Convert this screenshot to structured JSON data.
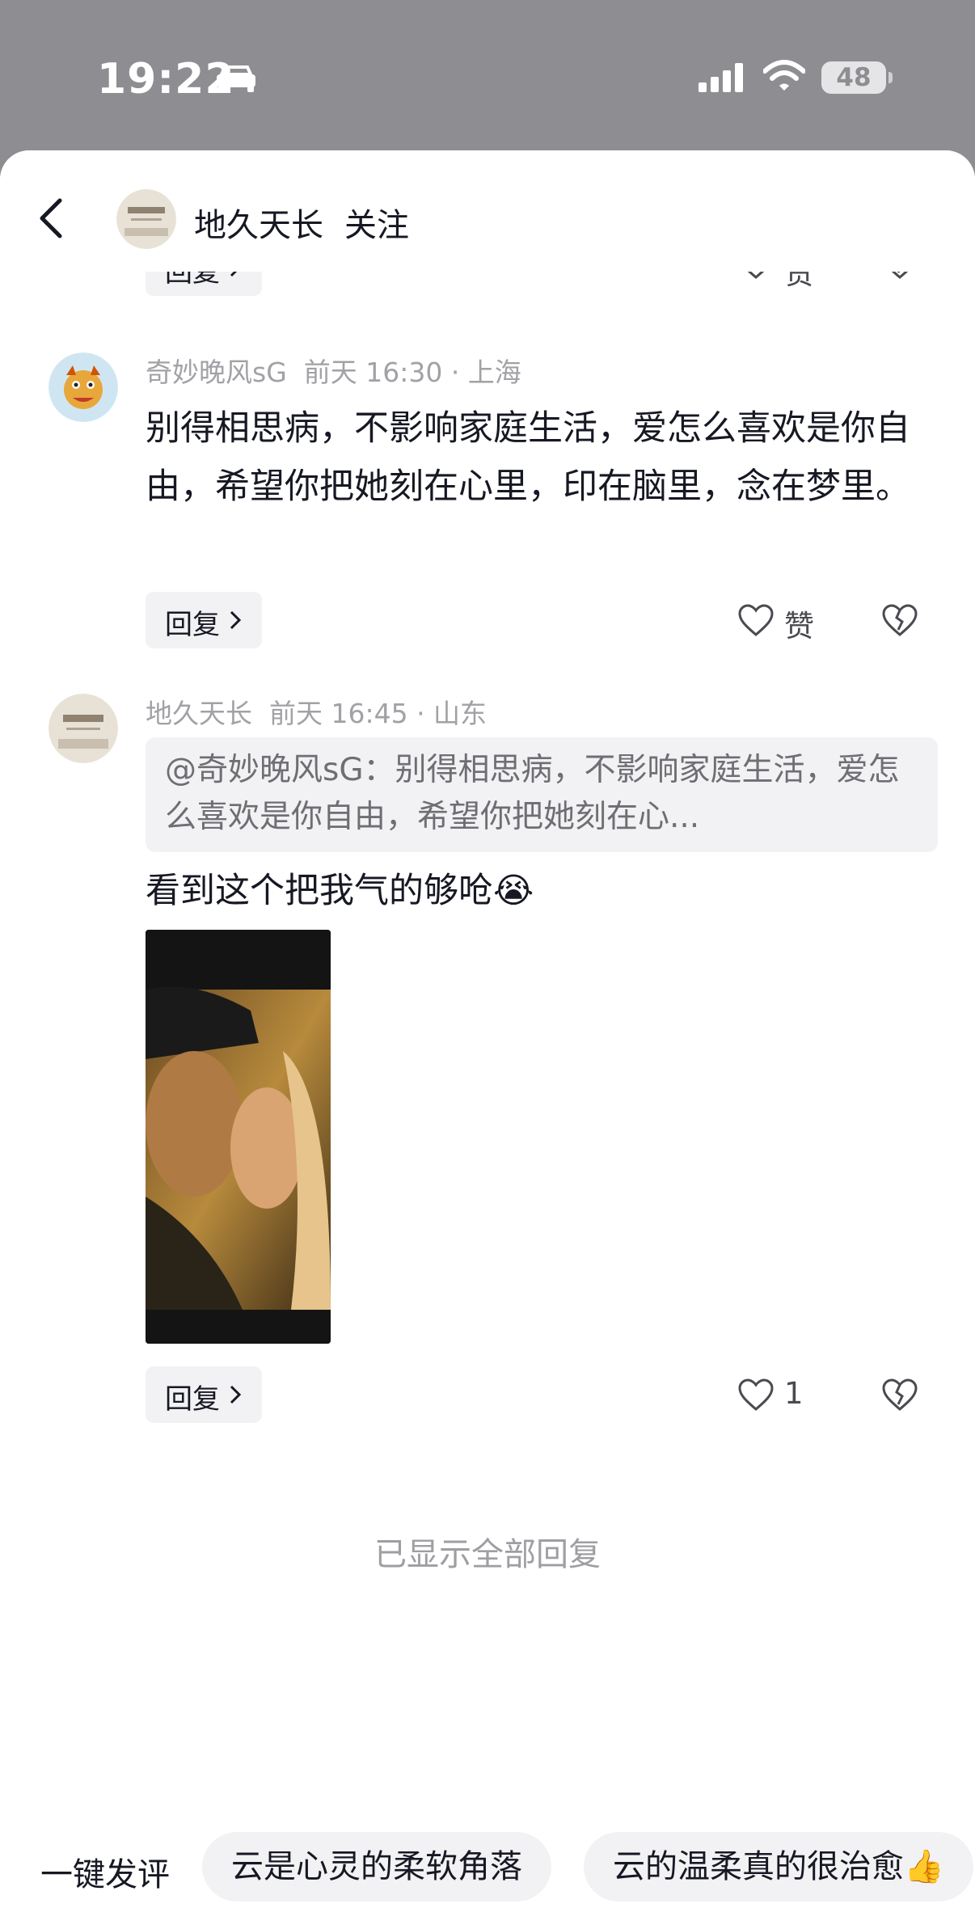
{
  "status_bar": {
    "time": "19:22",
    "battery": "48"
  },
  "header": {
    "username": "地久天长",
    "follow_label": "关注"
  },
  "top_partial": {
    "reply_label": "回复",
    "like_label": "赞"
  },
  "comments": [
    {
      "author": "奇妙晚风sG",
      "meta": "前天 16:30 · 上海",
      "text": "别得相思病，不影响家庭生活，爱怎么喜欢是你自由，希望你把她刻在心里，印在脑里，念在梦里。",
      "reply_label": "回复",
      "like_label": "赞"
    },
    {
      "author": "地久天长",
      "meta": "前天 16:45 · 山东",
      "quote": "@奇妙晚风sG：别得相思病，不影响家庭生活，爱怎么喜欢是你自由，希望你把她刻在心...",
      "text": "看到这个把我气的够呛😭",
      "reply_label": "回复",
      "like_label": "1"
    }
  ],
  "footer_note": "已显示全部回复",
  "quick_comments": {
    "lead": "一键发评",
    "chips": [
      "云是心灵的柔软角落",
      "云的温柔真的很治愈👍"
    ]
  },
  "icons": [
    "back-icon",
    "car-icon",
    "signal-icon",
    "wifi-icon",
    "battery-icon",
    "chevron-right-icon",
    "heart-icon",
    "broken-heart-icon"
  ],
  "colors": {
    "text": "#161823",
    "muted": "#a1a1a6",
    "chip_bg": "#f2f2f4",
    "status_bg": "#8e8e92"
  }
}
